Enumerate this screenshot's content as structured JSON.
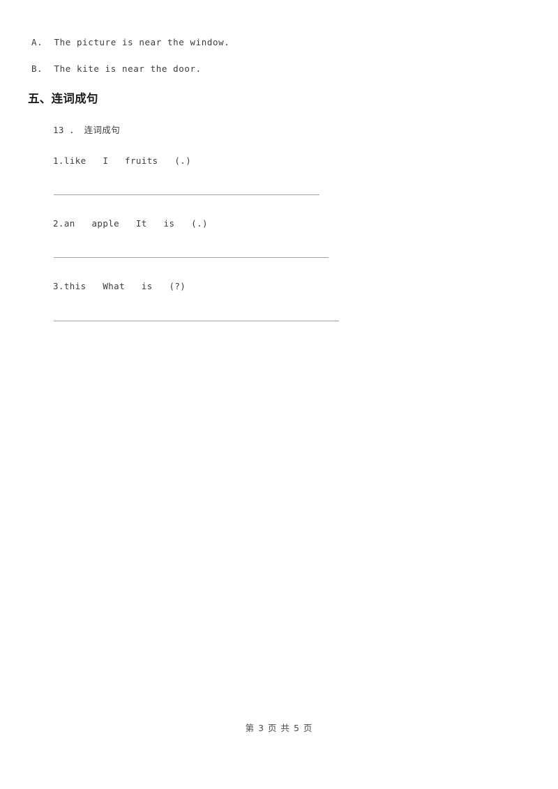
{
  "document": {
    "background_color": "#ffffff",
    "text_color": "#3c3c3c",
    "rule_color": "#a0a0a0"
  },
  "carried_options": [
    {
      "label": "A.  The picture is near the window."
    },
    {
      "label": "B.  The kite is near the door."
    }
  ],
  "section": {
    "heading": "五、连词成句"
  },
  "question": {
    "number_line": "13 ． 连词成句",
    "items": [
      {
        "prompt": "1.like   I   fruits   (.)",
        "answer_value": ""
      },
      {
        "prompt": "2.an   apple   It   is   (.)",
        "answer_value": ""
      },
      {
        "prompt": "3.this   What   is   (?)",
        "answer_value": ""
      }
    ]
  },
  "footer": {
    "page_indicator": "第 3 页 共 5 页",
    "current_page": "3",
    "total_pages": "5"
  }
}
